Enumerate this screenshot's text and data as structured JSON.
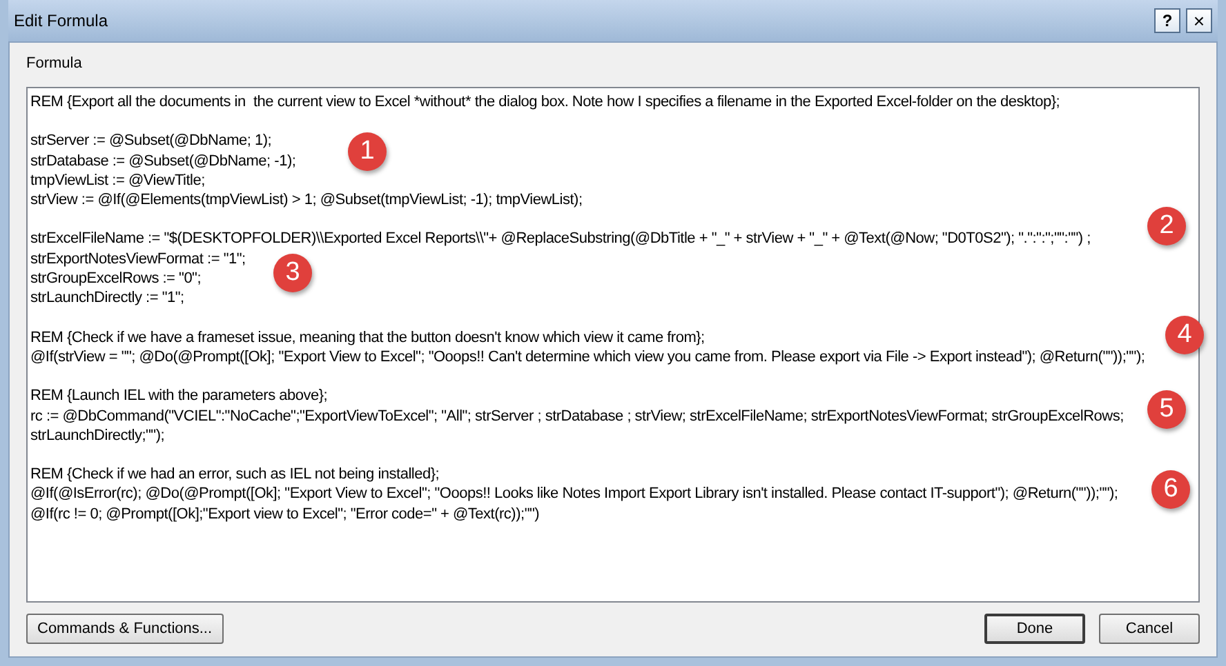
{
  "window": {
    "title": "Edit Formula",
    "help_button": "?",
    "close_button": "×"
  },
  "formula": {
    "label": "Formula",
    "blocks": [
      [
        "REM {Export all the documents in  the current view to Excel *without* the dialog box. Note how I specifies a filename in the Exported Excel-folder on the desktop};"
      ],
      [
        "strServer := @Subset(@DbName; 1);",
        "strDatabase := @Subset(@DbName; -1);",
        "tmpViewList := @ViewTitle;",
        "strView := @If(@Elements(tmpViewList) > 1; @Subset(tmpViewList; -1); tmpViewList);"
      ],
      [
        "strExcelFileName := \"$(DESKTOPFOLDER)\\\\Exported Excel Reports\\\\\"+ @ReplaceSubstring(@DbTitle + \"_\" + strView + \"_\" + @Text(@Now; \"D0T0S2\"); \".\":\":\";\"\":\"\") ;",
        "strExportNotesViewFormat := \"1\";",
        "strGroupExcelRows := \"0\";",
        "strLaunchDirectly := \"1\";"
      ],
      [
        "REM {Check if we have a frameset issue, meaning that the button doesn't know which view it came from};",
        "@If(strView = \"\"; @Do(@Prompt([Ok]; \"Export View to Excel\"; \"Ooops!! Can't determine which view you came from. Please export via File -> Export instead\"); @Return(\"\"));\"\");"
      ],
      [
        "REM {Launch IEL with the parameters above};",
        "rc := @DbCommand(\"VCIEL\":\"NoCache\";\"ExportViewToExcel\"; \"All\"; strServer ; strDatabase ; strView; strExcelFileName; strExportNotesViewFormat; strGroupExcelRows;",
        "strLaunchDirectly;\"\");"
      ],
      [
        "REM {Check if we had an error, such as IEL not being installed};",
        "@If(@IsError(rc); @Do(@Prompt([Ok]; \"Export View to Excel\"; \"Ooops!! Looks like Notes Import Export Library isn't installed. Please contact IT-support\"); @Return(\"\"));\"\");",
        "@If(rc != 0; @Prompt([Ok];\"Export view to Excel\"; \"Error code=\" + @Text(rc));\"\")"
      ]
    ]
  },
  "markers": [
    "1",
    "2",
    "3",
    "4",
    "5",
    "6"
  ],
  "buttons": {
    "commands": "Commands & Functions...",
    "done": "Done",
    "cancel": "Cancel"
  }
}
